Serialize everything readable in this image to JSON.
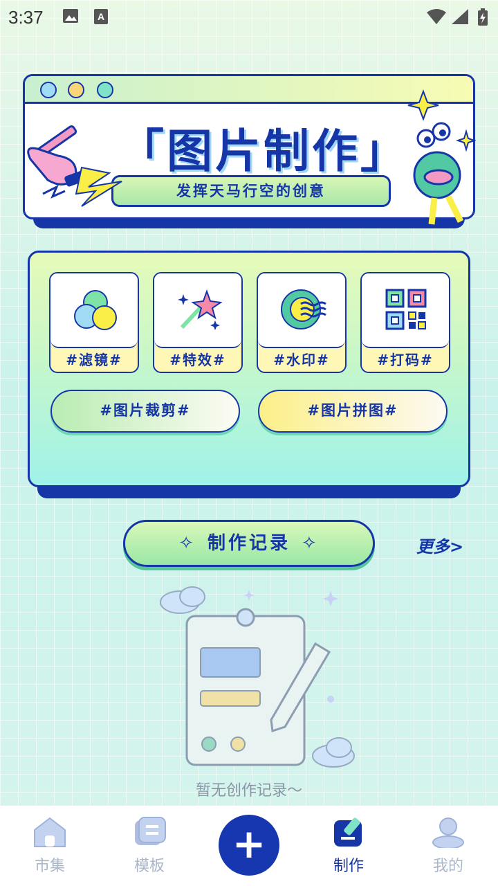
{
  "status_bar": {
    "time": "3:37",
    "icons": [
      "image-icon",
      "a-icon",
      "wifi-icon",
      "signal-icon",
      "battery-charging-icon"
    ]
  },
  "banner": {
    "title": "「图片制作」",
    "subtitle": "发挥天马行空的创意"
  },
  "tools": [
    {
      "label": "#滤镜#",
      "icon": "filter-circles-icon"
    },
    {
      "label": "#特效#",
      "icon": "magic-wand-icon"
    },
    {
      "label": "#水印#",
      "icon": "watermark-icon"
    },
    {
      "label": "#打码#",
      "icon": "mosaic-icon"
    }
  ],
  "wide_actions": [
    {
      "label": "#图片裁剪#"
    },
    {
      "label": "#图片拼图#"
    }
  ],
  "records": {
    "title": "制作记录",
    "more": "更多>",
    "empty_text": "暂无创作记录～"
  },
  "nav": {
    "items": [
      {
        "label": "市集",
        "icon": "home-icon"
      },
      {
        "label": "模板",
        "icon": "template-icon"
      },
      {
        "label": "+",
        "icon": "plus-icon"
      },
      {
        "label": "制作",
        "icon": "create-icon"
      },
      {
        "label": "我的",
        "icon": "profile-icon"
      }
    ],
    "active": "制作"
  },
  "colors": {
    "primary": "#1636a8",
    "accent_green": "#a8e7a8",
    "accent_yellow": "#fff7b6",
    "muted_text": "#8a96a8"
  }
}
